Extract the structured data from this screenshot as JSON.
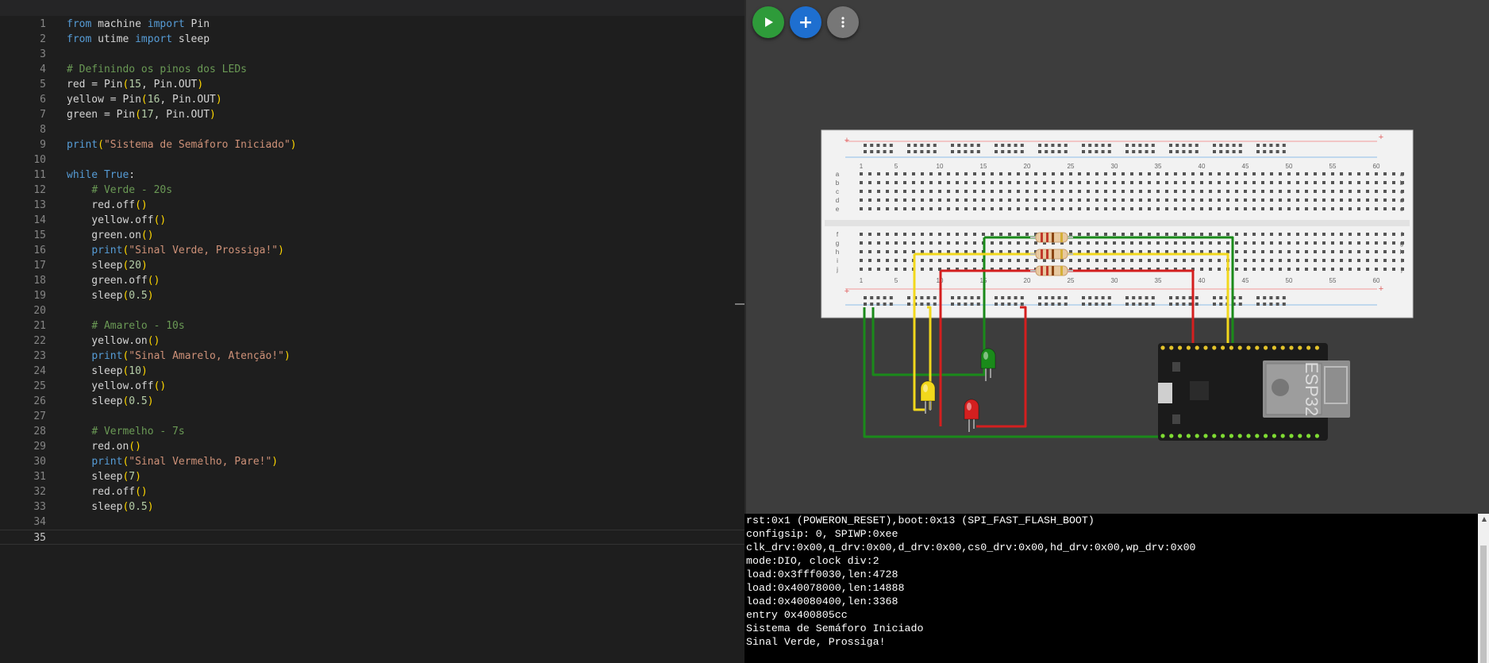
{
  "editor": {
    "lines": [
      [
        [
          "kw",
          "from"
        ],
        [
          "id",
          " machine "
        ],
        [
          "kw",
          "import"
        ],
        [
          "id",
          " Pin"
        ]
      ],
      [
        [
          "kw",
          "from"
        ],
        [
          "id",
          " utime "
        ],
        [
          "kw",
          "import"
        ],
        [
          "id",
          " sleep"
        ]
      ],
      [],
      [
        [
          "cm",
          "# Definindo os pinos dos LEDs"
        ]
      ],
      [
        [
          "id",
          "red = Pin"
        ],
        [
          "par",
          "("
        ],
        [
          "num",
          "15"
        ],
        [
          "id",
          ", Pin.OUT"
        ],
        [
          "par",
          ")"
        ]
      ],
      [
        [
          "id",
          "yellow = Pin"
        ],
        [
          "par",
          "("
        ],
        [
          "num",
          "16"
        ],
        [
          "id",
          ", Pin.OUT"
        ],
        [
          "par",
          ")"
        ]
      ],
      [
        [
          "id",
          "green = Pin"
        ],
        [
          "par",
          "("
        ],
        [
          "num",
          "17"
        ],
        [
          "id",
          ", Pin.OUT"
        ],
        [
          "par",
          ")"
        ]
      ],
      [],
      [
        [
          "fn",
          "print"
        ],
        [
          "par",
          "("
        ],
        [
          "str",
          "\"Sistema de Semáforo Iniciado\""
        ],
        [
          "par",
          ")"
        ]
      ],
      [],
      [
        [
          "kw",
          "while"
        ],
        [
          "id",
          " "
        ],
        [
          "kw",
          "True"
        ],
        [
          "id",
          ":"
        ]
      ],
      [
        [
          "id",
          "    "
        ],
        [
          "cm",
          "# Verde - 20s"
        ]
      ],
      [
        [
          "id",
          "    red.off"
        ],
        [
          "par",
          "()"
        ]
      ],
      [
        [
          "id",
          "    yellow.off"
        ],
        [
          "par",
          "()"
        ]
      ],
      [
        [
          "id",
          "    green.on"
        ],
        [
          "par",
          "()"
        ]
      ],
      [
        [
          "id",
          "    "
        ],
        [
          "fn",
          "print"
        ],
        [
          "par",
          "("
        ],
        [
          "str",
          "\"Sinal Verde, Prossiga!\""
        ],
        [
          "par",
          ")"
        ]
      ],
      [
        [
          "id",
          "    sleep"
        ],
        [
          "par",
          "("
        ],
        [
          "num",
          "20"
        ],
        [
          "par",
          ")"
        ]
      ],
      [
        [
          "id",
          "    green.off"
        ],
        [
          "par",
          "()"
        ]
      ],
      [
        [
          "id",
          "    sleep"
        ],
        [
          "par",
          "("
        ],
        [
          "num",
          "0.5"
        ],
        [
          "par",
          ")"
        ]
      ],
      [],
      [
        [
          "id",
          "    "
        ],
        [
          "cm",
          "# Amarelo - 10s"
        ]
      ],
      [
        [
          "id",
          "    yellow.on"
        ],
        [
          "par",
          "()"
        ]
      ],
      [
        [
          "id",
          "    "
        ],
        [
          "fn",
          "print"
        ],
        [
          "par",
          "("
        ],
        [
          "str",
          "\"Sinal Amarelo, Atenção!\""
        ],
        [
          "par",
          ")"
        ]
      ],
      [
        [
          "id",
          "    sleep"
        ],
        [
          "par",
          "("
        ],
        [
          "num",
          "10"
        ],
        [
          "par",
          ")"
        ]
      ],
      [
        [
          "id",
          "    yellow.off"
        ],
        [
          "par",
          "()"
        ]
      ],
      [
        [
          "id",
          "    sleep"
        ],
        [
          "par",
          "("
        ],
        [
          "num",
          "0.5"
        ],
        [
          "par",
          ")"
        ]
      ],
      [],
      [
        [
          "id",
          "    "
        ],
        [
          "cm",
          "# Vermelho - 7s"
        ]
      ],
      [
        [
          "id",
          "    red.on"
        ],
        [
          "par",
          "()"
        ]
      ],
      [
        [
          "id",
          "    "
        ],
        [
          "fn",
          "print"
        ],
        [
          "par",
          "("
        ],
        [
          "str",
          "\"Sinal Vermelho, Pare!\""
        ],
        [
          "par",
          ")"
        ]
      ],
      [
        [
          "id",
          "    sleep"
        ],
        [
          "par",
          "("
        ],
        [
          "num",
          "7"
        ],
        [
          "par",
          ")"
        ]
      ],
      [
        [
          "id",
          "    red.off"
        ],
        [
          "par",
          "()"
        ]
      ],
      [
        [
          "id",
          "    sleep"
        ],
        [
          "par",
          "("
        ],
        [
          "num",
          "0.5"
        ],
        [
          "par",
          ")"
        ]
      ],
      [],
      []
    ],
    "active_line": 35
  },
  "simulator": {
    "play_icon": "play-icon",
    "add_icon": "plus-icon",
    "more_icon": "more-vertical-icon",
    "breadboard": {
      "column_numbers": [
        "1",
        "5",
        "10",
        "15",
        "20",
        "25",
        "30",
        "35",
        "40",
        "45",
        "50",
        "55",
        "60"
      ],
      "row_letters_top": [
        "a",
        "b",
        "c",
        "d",
        "e"
      ],
      "row_letters_bottom": [
        "f",
        "g",
        "h",
        "i",
        "j"
      ],
      "rail_plus": "+",
      "rail_minus": "-"
    },
    "board_label": "ESP32",
    "colors": {
      "green": "#1a8a1a",
      "yellow": "#f2d81c",
      "red": "#d41f1f"
    }
  },
  "serial": {
    "lines": [
      "rst:0x1 (POWERON_RESET),boot:0x13 (SPI_FAST_FLASH_BOOT)",
      "configsip: 0, SPIWP:0xee",
      "clk_drv:0x00,q_drv:0x00,d_drv:0x00,cs0_drv:0x00,hd_drv:0x00,wp_drv:0x00",
      "mode:DIO, clock div:2",
      "load:0x3fff0030,len:4728",
      "load:0x40078000,len:14888",
      "load:0x40080400,len:3368",
      "entry 0x400805cc",
      "Sistema de Semáforo Iniciado",
      "Sinal Verde, Prossiga!"
    ]
  }
}
